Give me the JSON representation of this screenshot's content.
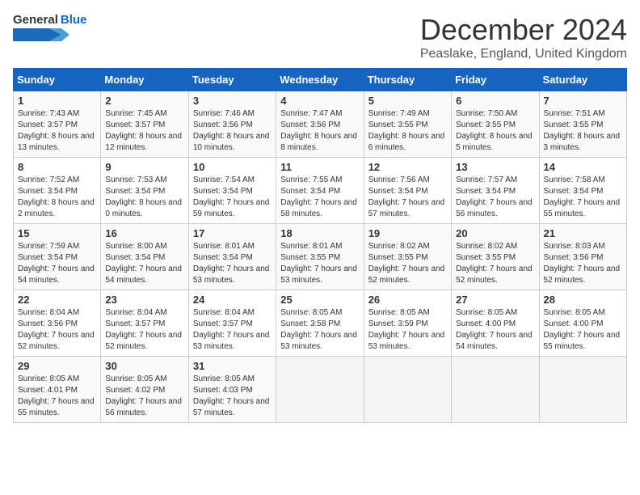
{
  "header": {
    "logo_general": "General",
    "logo_blue": "Blue",
    "title": "December 2024",
    "subtitle": "Peaslake, England, United Kingdom"
  },
  "days_of_week": [
    "Sunday",
    "Monday",
    "Tuesday",
    "Wednesday",
    "Thursday",
    "Friday",
    "Saturday"
  ],
  "weeks": [
    [
      {
        "day": 1,
        "sunrise": "Sunrise: 7:43 AM",
        "sunset": "Sunset: 3:57 PM",
        "daylight": "Daylight: 8 hours and 13 minutes."
      },
      {
        "day": 2,
        "sunrise": "Sunrise: 7:45 AM",
        "sunset": "Sunset: 3:57 PM",
        "daylight": "Daylight: 8 hours and 12 minutes."
      },
      {
        "day": 3,
        "sunrise": "Sunrise: 7:46 AM",
        "sunset": "Sunset: 3:56 PM",
        "daylight": "Daylight: 8 hours and 10 minutes."
      },
      {
        "day": 4,
        "sunrise": "Sunrise: 7:47 AM",
        "sunset": "Sunset: 3:56 PM",
        "daylight": "Daylight: 8 hours and 8 minutes."
      },
      {
        "day": 5,
        "sunrise": "Sunrise: 7:49 AM",
        "sunset": "Sunset: 3:55 PM",
        "daylight": "Daylight: 8 hours and 6 minutes."
      },
      {
        "day": 6,
        "sunrise": "Sunrise: 7:50 AM",
        "sunset": "Sunset: 3:55 PM",
        "daylight": "Daylight: 8 hours and 5 minutes."
      },
      {
        "day": 7,
        "sunrise": "Sunrise: 7:51 AM",
        "sunset": "Sunset: 3:55 PM",
        "daylight": "Daylight: 8 hours and 3 minutes."
      }
    ],
    [
      {
        "day": 8,
        "sunrise": "Sunrise: 7:52 AM",
        "sunset": "Sunset: 3:54 PM",
        "daylight": "Daylight: 8 hours and 2 minutes."
      },
      {
        "day": 9,
        "sunrise": "Sunrise: 7:53 AM",
        "sunset": "Sunset: 3:54 PM",
        "daylight": "Daylight: 8 hours and 0 minutes."
      },
      {
        "day": 10,
        "sunrise": "Sunrise: 7:54 AM",
        "sunset": "Sunset: 3:54 PM",
        "daylight": "Daylight: 7 hours and 59 minutes."
      },
      {
        "day": 11,
        "sunrise": "Sunrise: 7:55 AM",
        "sunset": "Sunset: 3:54 PM",
        "daylight": "Daylight: 7 hours and 58 minutes."
      },
      {
        "day": 12,
        "sunrise": "Sunrise: 7:56 AM",
        "sunset": "Sunset: 3:54 PM",
        "daylight": "Daylight: 7 hours and 57 minutes."
      },
      {
        "day": 13,
        "sunrise": "Sunrise: 7:57 AM",
        "sunset": "Sunset: 3:54 PM",
        "daylight": "Daylight: 7 hours and 56 minutes."
      },
      {
        "day": 14,
        "sunrise": "Sunrise: 7:58 AM",
        "sunset": "Sunset: 3:54 PM",
        "daylight": "Daylight: 7 hours and 55 minutes."
      }
    ],
    [
      {
        "day": 15,
        "sunrise": "Sunrise: 7:59 AM",
        "sunset": "Sunset: 3:54 PM",
        "daylight": "Daylight: 7 hours and 54 minutes."
      },
      {
        "day": 16,
        "sunrise": "Sunrise: 8:00 AM",
        "sunset": "Sunset: 3:54 PM",
        "daylight": "Daylight: 7 hours and 54 minutes."
      },
      {
        "day": 17,
        "sunrise": "Sunrise: 8:01 AM",
        "sunset": "Sunset: 3:54 PM",
        "daylight": "Daylight: 7 hours and 53 minutes."
      },
      {
        "day": 18,
        "sunrise": "Sunrise: 8:01 AM",
        "sunset": "Sunset: 3:55 PM",
        "daylight": "Daylight: 7 hours and 53 minutes."
      },
      {
        "day": 19,
        "sunrise": "Sunrise: 8:02 AM",
        "sunset": "Sunset: 3:55 PM",
        "daylight": "Daylight: 7 hours and 52 minutes."
      },
      {
        "day": 20,
        "sunrise": "Sunrise: 8:02 AM",
        "sunset": "Sunset: 3:55 PM",
        "daylight": "Daylight: 7 hours and 52 minutes."
      },
      {
        "day": 21,
        "sunrise": "Sunrise: 8:03 AM",
        "sunset": "Sunset: 3:56 PM",
        "daylight": "Daylight: 7 hours and 52 minutes."
      }
    ],
    [
      {
        "day": 22,
        "sunrise": "Sunrise: 8:04 AM",
        "sunset": "Sunset: 3:56 PM",
        "daylight": "Daylight: 7 hours and 52 minutes."
      },
      {
        "day": 23,
        "sunrise": "Sunrise: 8:04 AM",
        "sunset": "Sunset: 3:57 PM",
        "daylight": "Daylight: 7 hours and 52 minutes."
      },
      {
        "day": 24,
        "sunrise": "Sunrise: 8:04 AM",
        "sunset": "Sunset: 3:57 PM",
        "daylight": "Daylight: 7 hours and 53 minutes."
      },
      {
        "day": 25,
        "sunrise": "Sunrise: 8:05 AM",
        "sunset": "Sunset: 3:58 PM",
        "daylight": "Daylight: 7 hours and 53 minutes."
      },
      {
        "day": 26,
        "sunrise": "Sunrise: 8:05 AM",
        "sunset": "Sunset: 3:59 PM",
        "daylight": "Daylight: 7 hours and 53 minutes."
      },
      {
        "day": 27,
        "sunrise": "Sunrise: 8:05 AM",
        "sunset": "Sunset: 4:00 PM",
        "daylight": "Daylight: 7 hours and 54 minutes."
      },
      {
        "day": 28,
        "sunrise": "Sunrise: 8:05 AM",
        "sunset": "Sunset: 4:00 PM",
        "daylight": "Daylight: 7 hours and 55 minutes."
      }
    ],
    [
      {
        "day": 29,
        "sunrise": "Sunrise: 8:05 AM",
        "sunset": "Sunset: 4:01 PM",
        "daylight": "Daylight: 7 hours and 55 minutes."
      },
      {
        "day": 30,
        "sunrise": "Sunrise: 8:05 AM",
        "sunset": "Sunset: 4:02 PM",
        "daylight": "Daylight: 7 hours and 56 minutes."
      },
      {
        "day": 31,
        "sunrise": "Sunrise: 8:05 AM",
        "sunset": "Sunset: 4:03 PM",
        "daylight": "Daylight: 7 hours and 57 minutes."
      },
      null,
      null,
      null,
      null
    ]
  ]
}
